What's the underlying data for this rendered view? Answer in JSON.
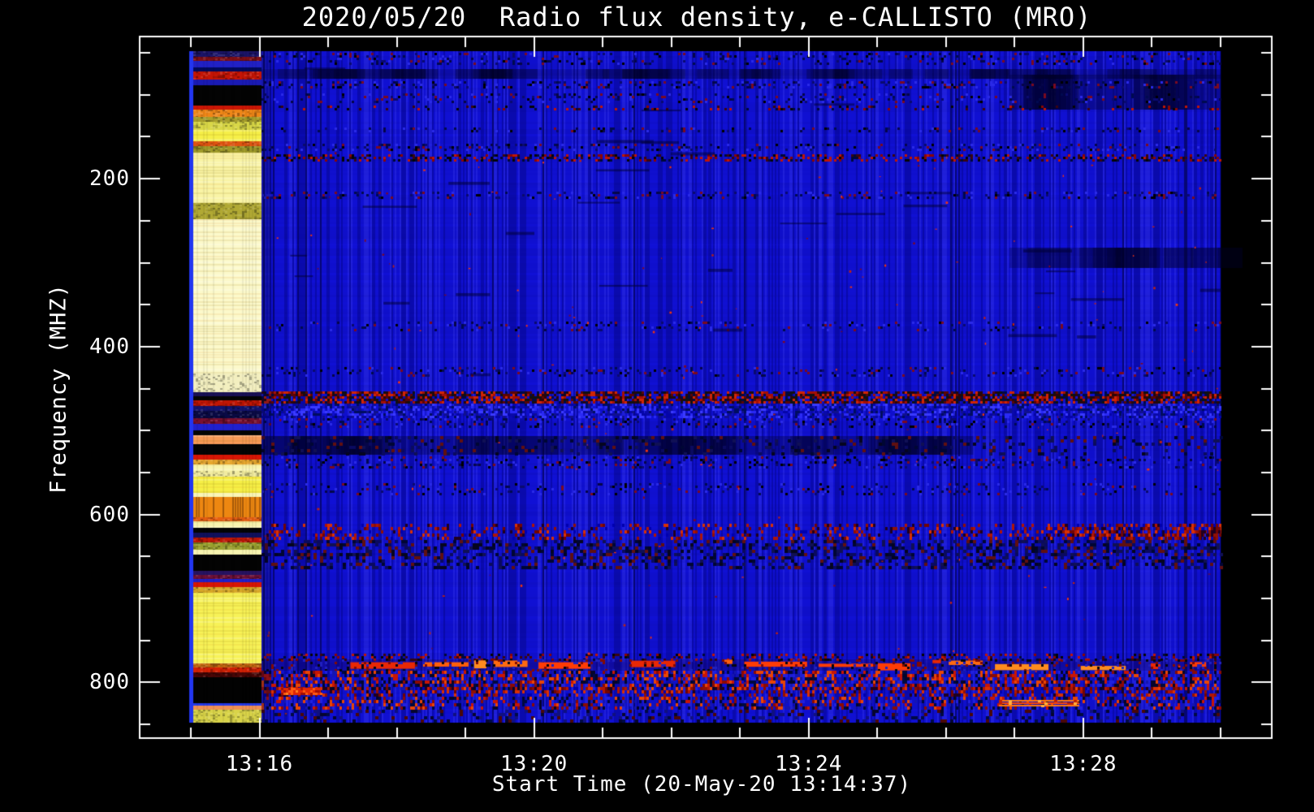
{
  "page": {
    "background": "#000000"
  },
  "title": "2020/05/20  Radio flux density, e-CALLISTO (MRO)",
  "chart_data": {
    "type": "heatmap",
    "subtype": "solar-radio-spectrogram",
    "title": "2020/05/20  Radio flux density, e-CALLISTO (MRO)",
    "xlabel": "Start Time (20-May-20 13:14:37)",
    "ylabel": "Frequency (MHZ)",
    "x_axis": {
      "unit": "time HH:MM",
      "start_min": 15,
      "end_min": 30,
      "hour": 13,
      "minor_step_min": 1,
      "major_ticks": [
        {
          "label": "13:16",
          "min": 16
        },
        {
          "label": "13:20",
          "min": 20
        },
        {
          "label": "13:24",
          "min": 24
        },
        {
          "label": "13:28",
          "min": 28
        }
      ]
    },
    "y_axis": {
      "unit": "MHz",
      "f_min": 48,
      "f_max": 848,
      "direction": "increasing-downward",
      "major_ticks": [
        200,
        400,
        600,
        800
      ],
      "minor_step": 50
    },
    "palette": {
      "base_blue": "#1111d6",
      "background": "#000000",
      "axis": "#ffffff",
      "text": "#ffffff",
      "bright_burst": "#ff4006",
      "calibration_yellow": "#fcf9cb"
    },
    "calibration_column": {
      "t0_min": 15.0,
      "t1_min": 16.05,
      "stripes": [
        {
          "f0": 48,
          "f1": 55,
          "c": "#1b1468",
          "t": "speck"
        },
        {
          "f0": 55,
          "f1": 60,
          "c": "#7d0e16",
          "t": "speck"
        },
        {
          "f0": 60,
          "f1": 67,
          "c": "#2121c6",
          "t": "flat"
        },
        {
          "f0": 67,
          "f1": 72,
          "c": "#000a5e",
          "t": "flat"
        },
        {
          "f0": 72,
          "f1": 82,
          "c": "#c41505",
          "t": "speck"
        },
        {
          "f0": 82,
          "f1": 89,
          "c": "#1a1ab4",
          "t": "flat"
        },
        {
          "f0": 89,
          "f1": 113,
          "c": "#030303",
          "t": "flat"
        },
        {
          "f0": 113,
          "f1": 118,
          "c": "#cc1605",
          "t": "flat"
        },
        {
          "f0": 118,
          "f1": 126,
          "c": "#ef8617",
          "t": "speck"
        },
        {
          "f0": 126,
          "f1": 132,
          "c": "#a89f2b",
          "t": "speck"
        },
        {
          "f0": 132,
          "f1": 142,
          "c": "#d9d747",
          "t": "speck"
        },
        {
          "f0": 142,
          "f1": 155,
          "c": "#f6ef48",
          "t": "rows"
        },
        {
          "f0": 155,
          "f1": 161,
          "c": "#df5411",
          "t": "speck"
        },
        {
          "f0": 161,
          "f1": 169,
          "c": "#9f9a29",
          "t": "speck"
        },
        {
          "f0": 169,
          "f1": 229,
          "c": "#f9f4a6",
          "t": "rows"
        },
        {
          "f0": 229,
          "f1": 248,
          "c": "#b1a934",
          "t": "speck"
        },
        {
          "f0": 248,
          "f1": 432,
          "c": "#fcf9cb",
          "t": "rows"
        },
        {
          "f0": 432,
          "f1": 454,
          "c": "#f3efbf",
          "t": "speck"
        },
        {
          "f0": 454,
          "f1": 459,
          "c": "#191055",
          "t": "flat"
        },
        {
          "f0": 459,
          "f1": 464,
          "c": "#050505",
          "t": "flat"
        },
        {
          "f0": 464,
          "f1": 471,
          "c": "#c11605",
          "t": "speck"
        },
        {
          "f0": 471,
          "f1": 477,
          "c": "#14146e",
          "t": "speck"
        },
        {
          "f0": 477,
          "f1": 485,
          "c": "#0a0a45",
          "t": "speck"
        },
        {
          "f0": 485,
          "f1": 492,
          "c": "#7a1030",
          "t": "speck"
        },
        {
          "f0": 492,
          "f1": 500,
          "c": "#2020ce",
          "t": "flat"
        },
        {
          "f0": 500,
          "f1": 506,
          "c": "#050505",
          "t": "flat"
        },
        {
          "f0": 506,
          "f1": 516,
          "c": "#f79a57",
          "t": "rows"
        },
        {
          "f0": 516,
          "f1": 529,
          "c": "#040404",
          "t": "flat"
        },
        {
          "f0": 529,
          "f1": 535,
          "c": "#d81605",
          "t": "flat"
        },
        {
          "f0": 535,
          "f1": 540,
          "c": "#e7a72f",
          "t": "speck"
        },
        {
          "f0": 540,
          "f1": 548,
          "c": "#f9f5ae",
          "t": "rows"
        },
        {
          "f0": 548,
          "f1": 555,
          "c": "#f1eb9e",
          "t": "speck"
        },
        {
          "f0": 555,
          "f1": 574,
          "c": "#f6ef46",
          "t": "rows"
        },
        {
          "f0": 574,
          "f1": 579,
          "c": "#faf6b6",
          "t": "flat"
        },
        {
          "f0": 579,
          "f1": 603,
          "c": "#ed8711",
          "t": "streak"
        },
        {
          "f0": 603,
          "f1": 608,
          "c": "#e65f13",
          "t": "speck"
        },
        {
          "f0": 608,
          "f1": 616,
          "c": "#f8f3ae",
          "t": "rows"
        },
        {
          "f0": 616,
          "f1": 622,
          "c": "#040404",
          "t": "flat"
        },
        {
          "f0": 622,
          "f1": 627,
          "c": "#10105c",
          "t": "flat"
        },
        {
          "f0": 627,
          "f1": 633,
          "c": "#bf1707",
          "t": "speck"
        },
        {
          "f0": 633,
          "f1": 642,
          "c": "#99a02d",
          "t": "speck"
        },
        {
          "f0": 642,
          "f1": 648,
          "c": "#f7f4b0",
          "t": "flat"
        },
        {
          "f0": 648,
          "f1": 667,
          "c": "#030303",
          "t": "flat"
        },
        {
          "f0": 667,
          "f1": 672,
          "c": "#271261",
          "t": "flat"
        },
        {
          "f0": 672,
          "f1": 677,
          "c": "#6e1038",
          "t": "speck"
        },
        {
          "f0": 677,
          "f1": 681,
          "c": "#2020ca",
          "t": "flat"
        },
        {
          "f0": 681,
          "f1": 686,
          "c": "#d71605",
          "t": "flat"
        },
        {
          "f0": 686,
          "f1": 693,
          "c": "#d7a727",
          "t": "speck"
        },
        {
          "f0": 693,
          "f1": 777,
          "c": "#f7f257",
          "t": "rows"
        },
        {
          "f0": 777,
          "f1": 782,
          "c": "#c76a11",
          "t": "speck"
        },
        {
          "f0": 782,
          "f1": 788,
          "c": "#d32105",
          "t": "speck"
        },
        {
          "f0": 788,
          "f1": 794,
          "c": "#4b0606",
          "t": "speck"
        },
        {
          "f0": 794,
          "f1": 825,
          "c": "#020202",
          "t": "flat"
        },
        {
          "f0": 825,
          "f1": 828,
          "c": "#2439e9",
          "t": "flat"
        },
        {
          "f0": 828,
          "f1": 833,
          "c": "#ef8f54",
          "t": "flat"
        },
        {
          "f0": 833,
          "f1": 848,
          "c": "#d9d449",
          "t": "speck"
        }
      ]
    },
    "main_field": {
      "base": "#1111d6",
      "features": [
        {
          "f0": 50,
          "f1": 64,
          "type": "speckrow",
          "s": 0.35
        },
        {
          "f0": 69,
          "f1": 81,
          "type": "smudge",
          "s": 0.5
        },
        {
          "f0": 76,
          "f1": 118,
          "type": "smudge",
          "x0": 0.78,
          "x1": 1,
          "s": 0.75
        },
        {
          "f0": 84,
          "f1": 91,
          "type": "speckrow",
          "s": 0.5
        },
        {
          "f0": 98,
          "f1": 108,
          "type": "speckrow",
          "s": 0.3
        },
        {
          "f0": 113,
          "f1": 118,
          "type": "redrow",
          "s": 0.35
        },
        {
          "f0": 139,
          "f1": 145,
          "type": "speckrow",
          "s": 0.3
        },
        {
          "f0": 158,
          "f1": 166,
          "type": "speckrow",
          "s": 0.4
        },
        {
          "f0": 171,
          "f1": 180,
          "type": "redrow",
          "s": 0.7
        },
        {
          "f0": 215,
          "f1": 222,
          "type": "speckrow",
          "s": 0.45
        },
        {
          "f0": 282,
          "f1": 306,
          "type": "smudge",
          "x0": 0.78,
          "x1": 1,
          "s": 0.6
        },
        {
          "f0": 370,
          "f1": 380,
          "type": "speckrow",
          "s": 0.25
        },
        {
          "f0": 424,
          "f1": 434,
          "type": "speckrow",
          "s": 0.3
        },
        {
          "f0": 453,
          "f1": 468,
          "type": "redblack",
          "s": 0.9
        },
        {
          "f0": 468,
          "f1": 485,
          "type": "bluespeck",
          "s": 0.75
        },
        {
          "f0": 485,
          "f1": 497,
          "type": "speckrow",
          "s": 0.4
        },
        {
          "f0": 507,
          "f1": 529,
          "type": "smudge",
          "x0": 0,
          "x1": 0.72,
          "s": 0.7
        },
        {
          "f0": 507,
          "f1": 529,
          "type": "darkmottle",
          "s": 0.3
        },
        {
          "f0": 531,
          "f1": 545,
          "type": "speckrow",
          "s": 0.4
        },
        {
          "f0": 563,
          "f1": 575,
          "type": "speckrow",
          "s": 0.28
        },
        {
          "f0": 611,
          "f1": 630,
          "type": "redmottle",
          "s": 0.45
        },
        {
          "f0": 611,
          "f1": 630,
          "type": "redmottle",
          "x0": 0.82,
          "x1": 1,
          "s": 1
        },
        {
          "f0": 630,
          "f1": 662,
          "type": "darkmottle",
          "s": 0.6
        },
        {
          "f0": 766,
          "f1": 773,
          "type": "redrow",
          "s": 0.5
        },
        {
          "f0": 773,
          "f1": 786,
          "type": "brightdash",
          "s": 1
        },
        {
          "f0": 786,
          "f1": 806,
          "type": "mixedspeck",
          "s": 0.85
        },
        {
          "f0": 805,
          "f1": 817,
          "type": "redmottle",
          "s": 0.7
        },
        {
          "f0": 806,
          "f1": 815,
          "type": "blob",
          "x0": 0.02,
          "x1": 0.062,
          "s": 1
        },
        {
          "f0": 817,
          "f1": 833,
          "type": "mixedspeck",
          "s": 0.6
        },
        {
          "f0": 821,
          "f1": 830,
          "type": "brightrun",
          "x0": 0.769,
          "x1": 0.853,
          "s": 1
        },
        {
          "f0": 833,
          "f1": 848,
          "type": "fademottle",
          "s": 0.5
        }
      ]
    }
  }
}
